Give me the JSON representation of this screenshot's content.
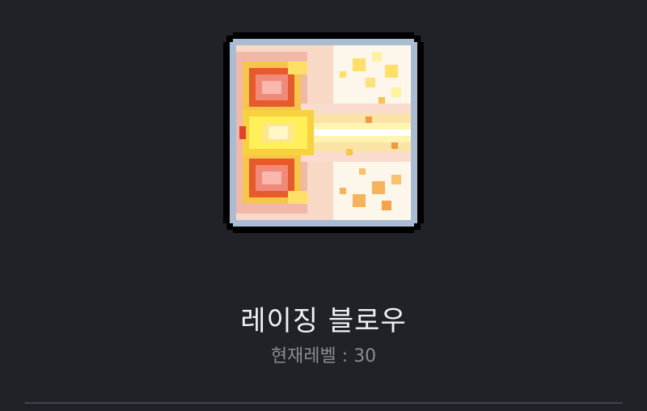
{
  "skill": {
    "name": "레이징 블로우",
    "icon": "raging-blow-icon",
    "level_label": "현재레벨",
    "level_separator": " : ",
    "level_value": "30"
  },
  "colors": {
    "background": "#212227",
    "title_text": "#f2f2f4",
    "subtitle_text": "#8b8c93",
    "divider": "#41424b"
  }
}
